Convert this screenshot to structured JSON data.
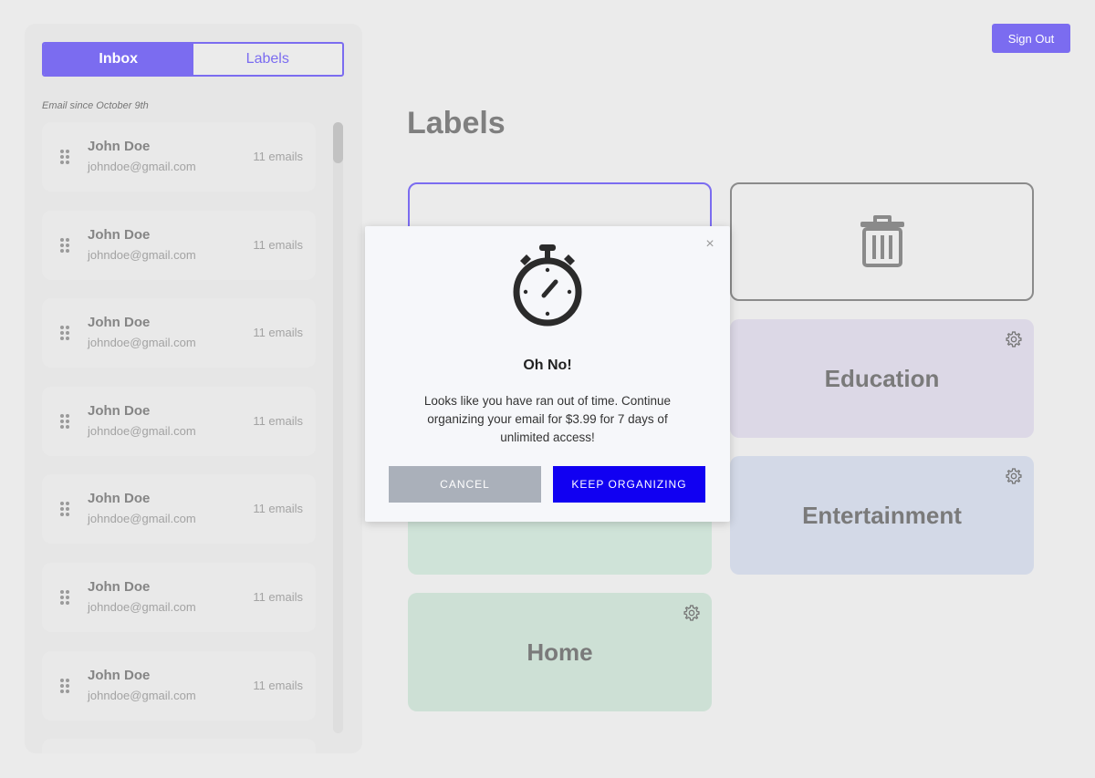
{
  "sidebar": {
    "tabs": {
      "inbox": "Inbox",
      "labels": "Labels"
    },
    "since_text": "Email since October 9th",
    "senders": [
      {
        "name": "John Doe",
        "email": "johndoe@gmail.com",
        "count": "11 emails"
      },
      {
        "name": "John Doe",
        "email": "johndoe@gmail.com",
        "count": "11 emails"
      },
      {
        "name": "John Doe",
        "email": "johndoe@gmail.com",
        "count": "11 emails"
      },
      {
        "name": "John Doe",
        "email": "johndoe@gmail.com",
        "count": "11 emails"
      },
      {
        "name": "John Doe",
        "email": "johndoe@gmail.com",
        "count": "11 emails"
      },
      {
        "name": "John Doe",
        "email": "johndoe@gmail.com",
        "count": "11 emails"
      },
      {
        "name": "John Doe",
        "email": "johndoe@gmail.com",
        "count": "11 emails"
      }
    ]
  },
  "header": {
    "sign_out": "Sign Out"
  },
  "main": {
    "title": "Labels",
    "tiles": {
      "education": "Education",
      "entertainment": "Entertainment",
      "home": "Home"
    }
  },
  "modal": {
    "title": "Oh No!",
    "body": "Looks like you have ran out of time. Continue organizing your email for $3.99 for 7 days of unlimited access!",
    "close": "×",
    "cancel": "CANCEL",
    "keep": "KEEP ORGANIZING"
  },
  "colors": {
    "accent": "#7b6cf0",
    "primary_button": "#1100f2",
    "cancel_button": "#aab0ba",
    "education_tile": "#dcd8e6",
    "entertainment_tile": "#d3d9e7",
    "home_tile": "#cde0d5"
  },
  "icons": {
    "modal": "stopwatch-icon",
    "trash_tile": "trash-icon",
    "tile_settings": "gear-icon",
    "drag": "drag-handle-icon"
  }
}
